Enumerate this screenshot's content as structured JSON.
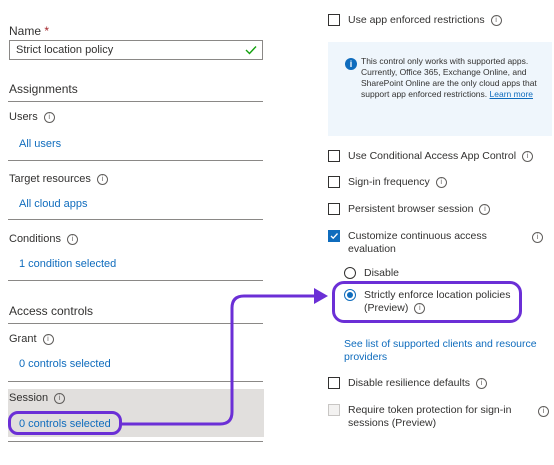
{
  "left": {
    "name_label": "Name",
    "name_required": "*",
    "name_value": "Strict location policy",
    "assignments_header": "Assignments",
    "users_label": "Users",
    "users_link": "All users",
    "target_label": "Target resources",
    "target_link": "All cloud apps",
    "conditions_label": "Conditions",
    "conditions_link": "1 condition selected",
    "access_controls_header": "Access controls",
    "grant_label": "Grant",
    "grant_link": "0 controls selected",
    "session_label": "Session",
    "session_link": "0 controls selected"
  },
  "right": {
    "app_enforced": "Use app enforced restrictions",
    "infobox_text": "This control only works with supported apps. Currently, Office 365, Exchange Online, and SharePoint Online are the only cloud apps that support app enforced restrictions.",
    "infobox_link": "Learn more",
    "cond_access_app": "Use Conditional Access App Control",
    "signin_freq": "Sign-in frequency",
    "persistent_browser": "Persistent browser session",
    "cae_line1": "Customize continuous access",
    "cae_line2": "evaluation",
    "radio_disable": "Disable",
    "radio_strict_line1": "Strictly enforce location policies",
    "radio_strict_line2": "(Preview)",
    "supported_link_line1": "See list of supported clients and resource",
    "supported_link_line2": "providers",
    "disable_resilience": "Disable resilience defaults",
    "token_line1": "Require token protection for sign-in",
    "token_line2": "sessions (Preview)"
  },
  "colors": {
    "accent": "#0f6cbd",
    "callout": "#6b2fd6",
    "infobox_bg": "#eff6fc",
    "session_bg": "#e1dfdd",
    "checkmark": "#13a10e"
  },
  "icons": {
    "info": "info-circle-icon",
    "checkmark": "checkmark-icon"
  }
}
